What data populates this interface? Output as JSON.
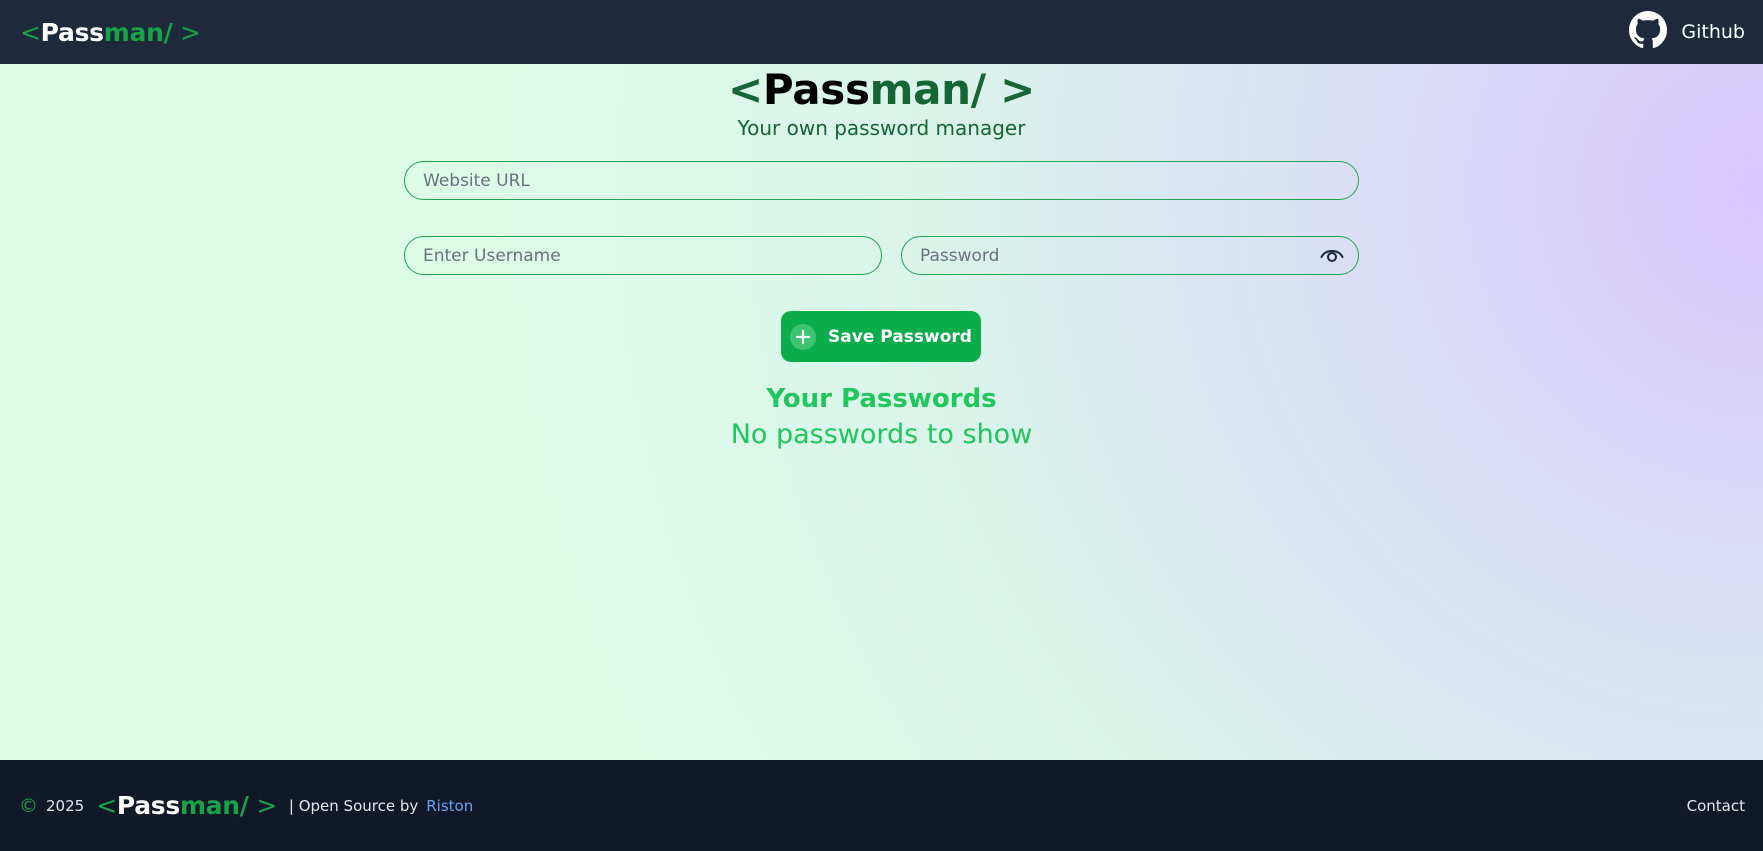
{
  "nav": {
    "logo": {
      "open": "<",
      "pass": "Pass",
      "man": "man/",
      "close": " >"
    },
    "github_label": "Github"
  },
  "hero": {
    "logo": {
      "open": "<",
      "pass": "Pass",
      "man": "man/",
      "close": " >"
    },
    "tagline": "Your own password manager"
  },
  "form": {
    "url_placeholder": "Website URL",
    "url_value": "",
    "username_placeholder": "Enter Username",
    "username_value": "",
    "password_placeholder": "Password",
    "password_value": "",
    "save_label": "Save Password"
  },
  "passwords": {
    "title": "Your Passwords",
    "empty_message": "No passwords to show"
  },
  "footer": {
    "copyright_symbol": "©",
    "year": "2025",
    "logo": {
      "open": "<",
      "pass": "Pass",
      "man": "man/",
      "close": " >"
    },
    "credit_prefix": "| Open Source by",
    "author": "Riston",
    "contact_label": "Contact"
  },
  "icons": {
    "nav_github": "github-icon",
    "password_toggle": "eye-icon",
    "save": "plus-circle-icon"
  },
  "colors": {
    "nav_bg": "#1e293b",
    "footer_bg": "#111827",
    "accent": "#16a34a",
    "button": "#0aad4a",
    "link": "#60a5fa"
  }
}
